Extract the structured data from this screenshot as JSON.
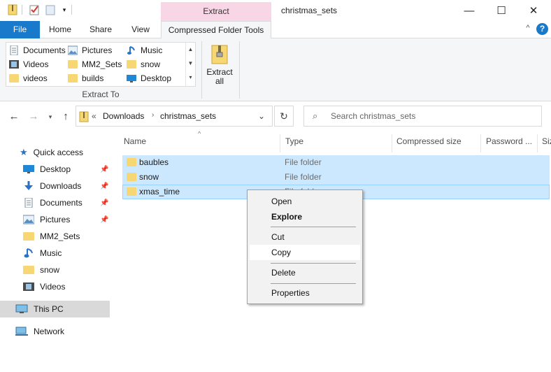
{
  "window": {
    "title": "christmas_sets",
    "contextual_header": "Extract",
    "controls": {
      "minimize": "—",
      "maximize": "☐",
      "close": "✕"
    }
  },
  "ribbon": {
    "tabs": [
      "File",
      "Home",
      "Share",
      "View",
      "Compressed Folder Tools"
    ],
    "active_tab": "Compressed Folder Tools",
    "extract_to": {
      "items": [
        "Documents",
        "Pictures",
        "Music",
        "Videos",
        "MM2_Sets",
        "snow",
        "videos",
        "builds",
        "Desktop"
      ],
      "group_label": "Extract To"
    },
    "extract_all": {
      "line1": "Extract",
      "line2": "all"
    }
  },
  "address": {
    "prefix": "«",
    "crumbs": [
      "Downloads",
      "christmas_sets"
    ],
    "search_placeholder": "Search christmas_sets"
  },
  "nav_pane": {
    "quick_access": "Quick access",
    "items": [
      "Desktop",
      "Downloads",
      "Documents",
      "Pictures",
      "MM2_Sets",
      "Music",
      "snow",
      "Videos"
    ],
    "this_pc": "This PC",
    "network": "Network"
  },
  "file_list": {
    "columns": [
      "Name",
      "Type",
      "Compressed size",
      "Password ...",
      "Siz"
    ],
    "rows": [
      {
        "name": "baubles",
        "type": "File folder"
      },
      {
        "name": "snow",
        "type": "File folder"
      },
      {
        "name": "xmas_time",
        "type": "File folder"
      }
    ]
  },
  "context_menu": {
    "items": [
      "Open",
      "Explore",
      "Cut",
      "Copy",
      "Delete",
      "Properties"
    ],
    "hovered": "Copy"
  },
  "colors": {
    "file_tab": "#1979ca",
    "selection": "#cce8ff",
    "contextual_tab": "#f8d6e5",
    "folder": "#f7d774",
    "help": "#1979ca"
  }
}
